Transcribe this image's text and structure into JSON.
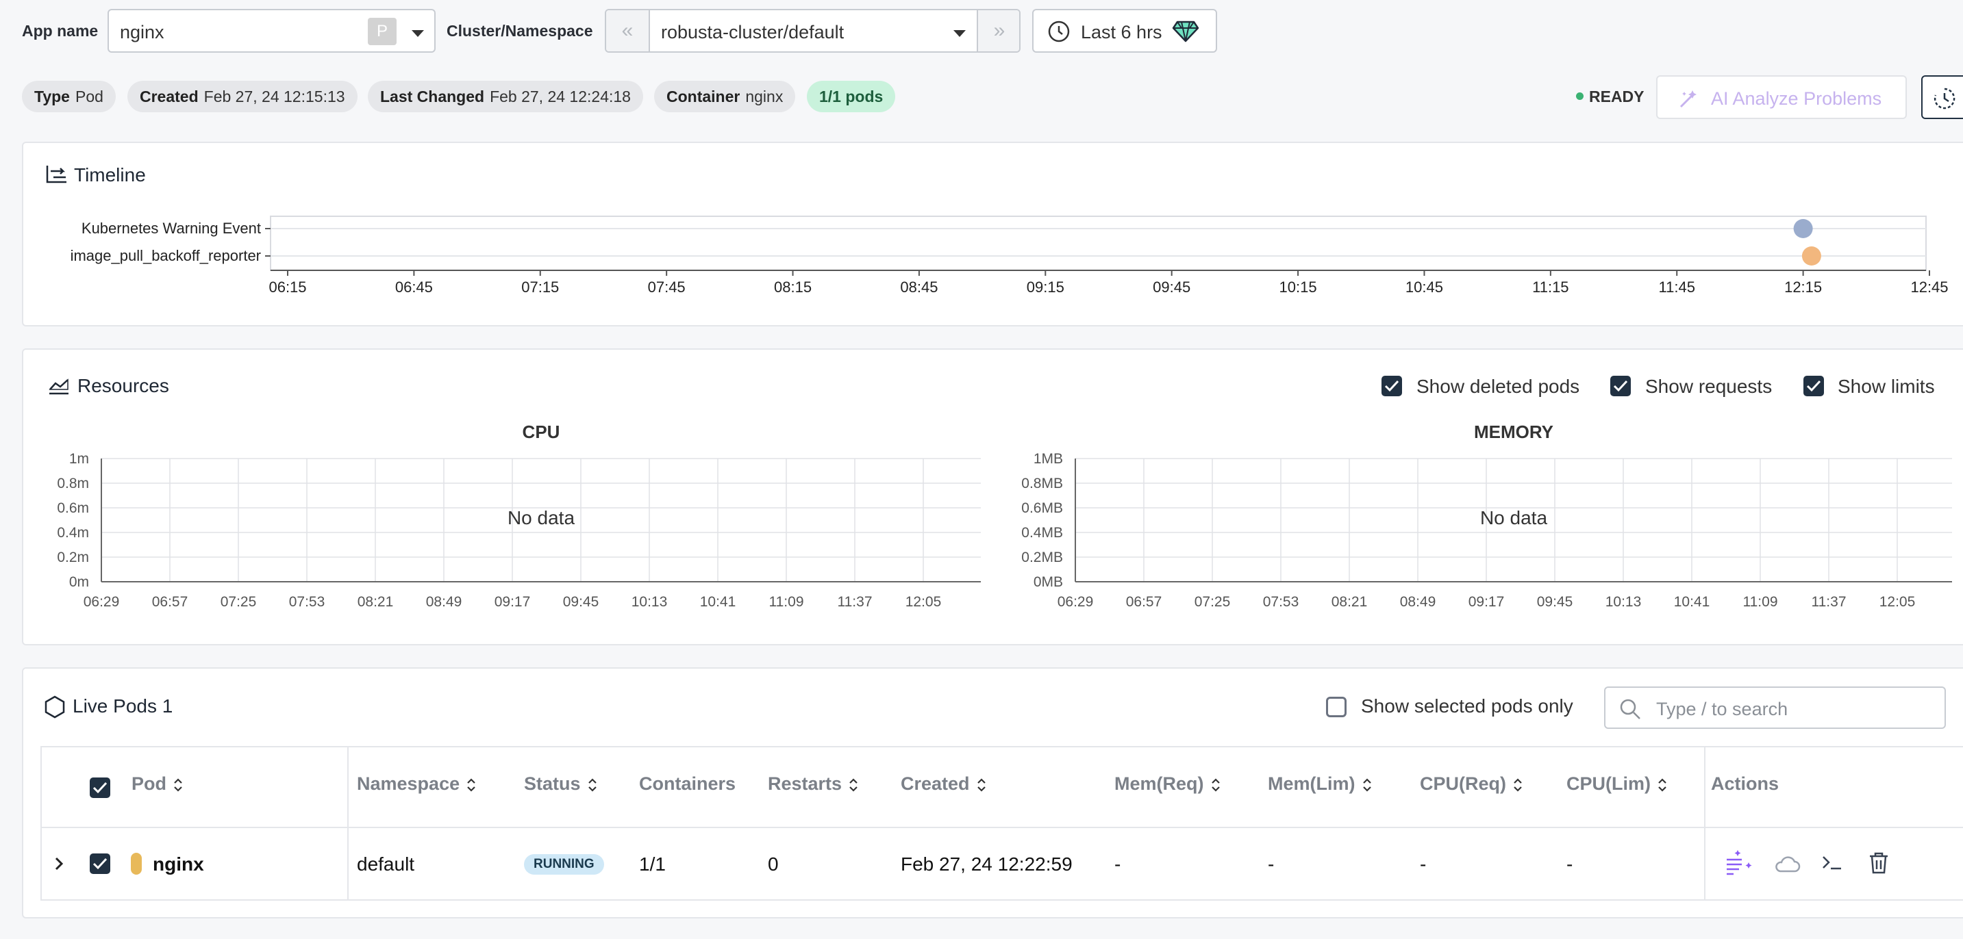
{
  "header": {
    "app_name_label": "App name",
    "app_name_value": "nginx",
    "app_badge": "P",
    "cluster_label": "Cluster/Namespace",
    "cluster_value": "robusta-cluster/default",
    "time_range": "Last 6 hrs"
  },
  "info": {
    "type_label": "Type",
    "type_value": "Pod",
    "created_label": "Created",
    "created_value": "Feb 27, 24 12:15:13",
    "changed_label": "Last Changed",
    "changed_value": "Feb 27, 24 12:24:18",
    "container_label": "Container",
    "container_value": "nginx",
    "pods_badge": "1/1 pods",
    "status": "READY",
    "ai_button": "AI Analyze Problems"
  },
  "timeline": {
    "title": "Timeline",
    "rows": [
      "Kubernetes Warning Event",
      "image_pull_backoff_reporter"
    ],
    "ticks": [
      "06:15",
      "06:45",
      "07:15",
      "07:45",
      "08:15",
      "08:45",
      "09:15",
      "09:45",
      "10:15",
      "10:45",
      "11:15",
      "11:45",
      "12:15",
      "12:45"
    ],
    "events": [
      {
        "row": 0,
        "time": "12:15",
        "color": "#9aaccd"
      },
      {
        "row": 1,
        "time": "12:17",
        "color": "#f2b77e"
      }
    ]
  },
  "resources": {
    "title": "Resources",
    "show_deleted": "Show deleted pods",
    "show_requests": "Show requests",
    "show_limits": "Show limits",
    "cpu": {
      "title": "CPU",
      "y_ticks": [
        "1m",
        "0.8m",
        "0.6m",
        "0.4m",
        "0.2m",
        "0m"
      ],
      "empty": "No data"
    },
    "memory": {
      "title": "MEMORY",
      "y_ticks": [
        "1MB",
        "0.8MB",
        "0.6MB",
        "0.4MB",
        "0.2MB",
        "0MB"
      ],
      "empty": "No data"
    },
    "x_ticks": [
      "06:29",
      "06:57",
      "07:25",
      "07:53",
      "08:21",
      "08:49",
      "09:17",
      "09:45",
      "10:13",
      "10:41",
      "11:09",
      "11:37",
      "12:05"
    ]
  },
  "pods": {
    "title": "Live Pods 1",
    "show_selected": "Show selected pods only",
    "search_placeholder": "Type / to search",
    "columns": [
      "Pod",
      "Namespace",
      "Status",
      "Containers",
      "Restarts",
      "Created",
      "Mem(Req)",
      "Mem(Lim)",
      "CPU(Req)",
      "CPU(Lim)",
      "Actions"
    ],
    "rows": [
      {
        "name": "nginx",
        "namespace": "default",
        "status": "RUNNING",
        "containers": "1/1",
        "restarts": "0",
        "created": "Feb 27, 24 12:22:59",
        "mem_req": "-",
        "mem_lim": "-",
        "cpu_req": "-",
        "cpu_lim": "-"
      }
    ]
  },
  "colors": {
    "accent": "#213142",
    "ready": "#3bb273",
    "running_bg": "#cfe8f7",
    "pods_badge_bg": "#c9f2dc",
    "ai_text": "#c6b2ee",
    "pod_marker": "#e8b95a"
  }
}
